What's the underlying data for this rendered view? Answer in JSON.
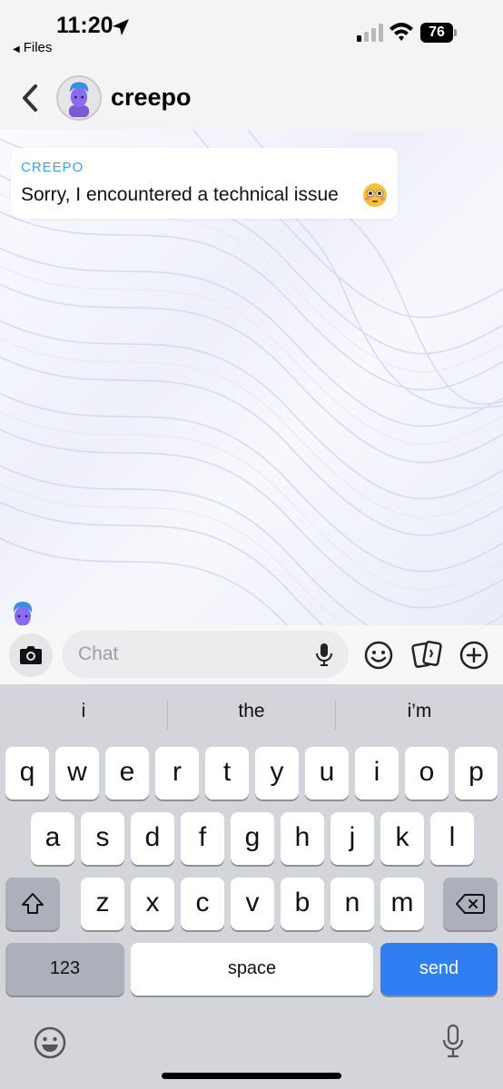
{
  "status_bar": {
    "time": "11:20",
    "back_app": "Files",
    "battery": "76",
    "icons": [
      "location-arrow-icon",
      "signal-icon",
      "wifi-icon",
      "battery-icon"
    ]
  },
  "header": {
    "title": "creepo",
    "icons": [
      "back-chevron-icon",
      "avatar"
    ]
  },
  "messages": [
    {
      "sender": "CREEPO",
      "text": "Sorry, I encountered a technical issue",
      "emoji": "flushed-face-emoji"
    }
  ],
  "input_bar": {
    "placeholder": "Chat",
    "icons": [
      "camera-icon",
      "microphone-icon",
      "smiley-icon",
      "cards-icon",
      "plus-icon"
    ]
  },
  "keyboard": {
    "suggestions": [
      "i",
      "the",
      "i’m"
    ],
    "row1": [
      "q",
      "w",
      "e",
      "r",
      "t",
      "y",
      "u",
      "i",
      "o",
      "p"
    ],
    "row2": [
      "a",
      "s",
      "d",
      "f",
      "g",
      "h",
      "j",
      "k",
      "l"
    ],
    "row3": [
      "z",
      "x",
      "c",
      "v",
      "b",
      "n",
      "m"
    ],
    "numbers_key": "123",
    "space_key": "space",
    "send_key": "send",
    "send_color": "#2f7ff2",
    "icons": [
      "shift-icon",
      "backspace-icon",
      "emoji-icon",
      "dictation-mic-icon"
    ]
  }
}
